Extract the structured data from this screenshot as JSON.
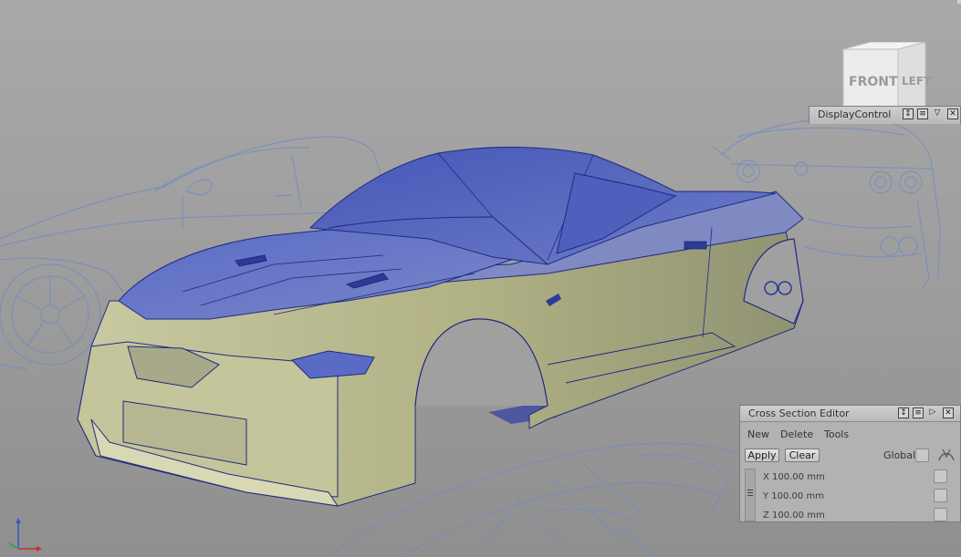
{
  "viewport": {
    "view_cube": {
      "front_label": "FRONT",
      "left_label": "LEFT"
    }
  },
  "display_control": {
    "title": "DisplayControl"
  },
  "cross_section_editor": {
    "title": "Cross Section Editor",
    "menu": [
      "New",
      "Delete",
      "Tools"
    ],
    "apply_label": "Apply",
    "clear_label": "Clear",
    "global_label": "Global",
    "rows": [
      {
        "label": "X 100.00 mm"
      },
      {
        "label": "Y 100.00 mm"
      },
      {
        "label": "Z 100.00 mm"
      }
    ]
  },
  "colors": {
    "viewport_bg": "#a0a0a0",
    "body_blue": "#5a6fc4",
    "body_khaki": "#b8b98a",
    "sketch_blue": "#6f8cc2"
  }
}
